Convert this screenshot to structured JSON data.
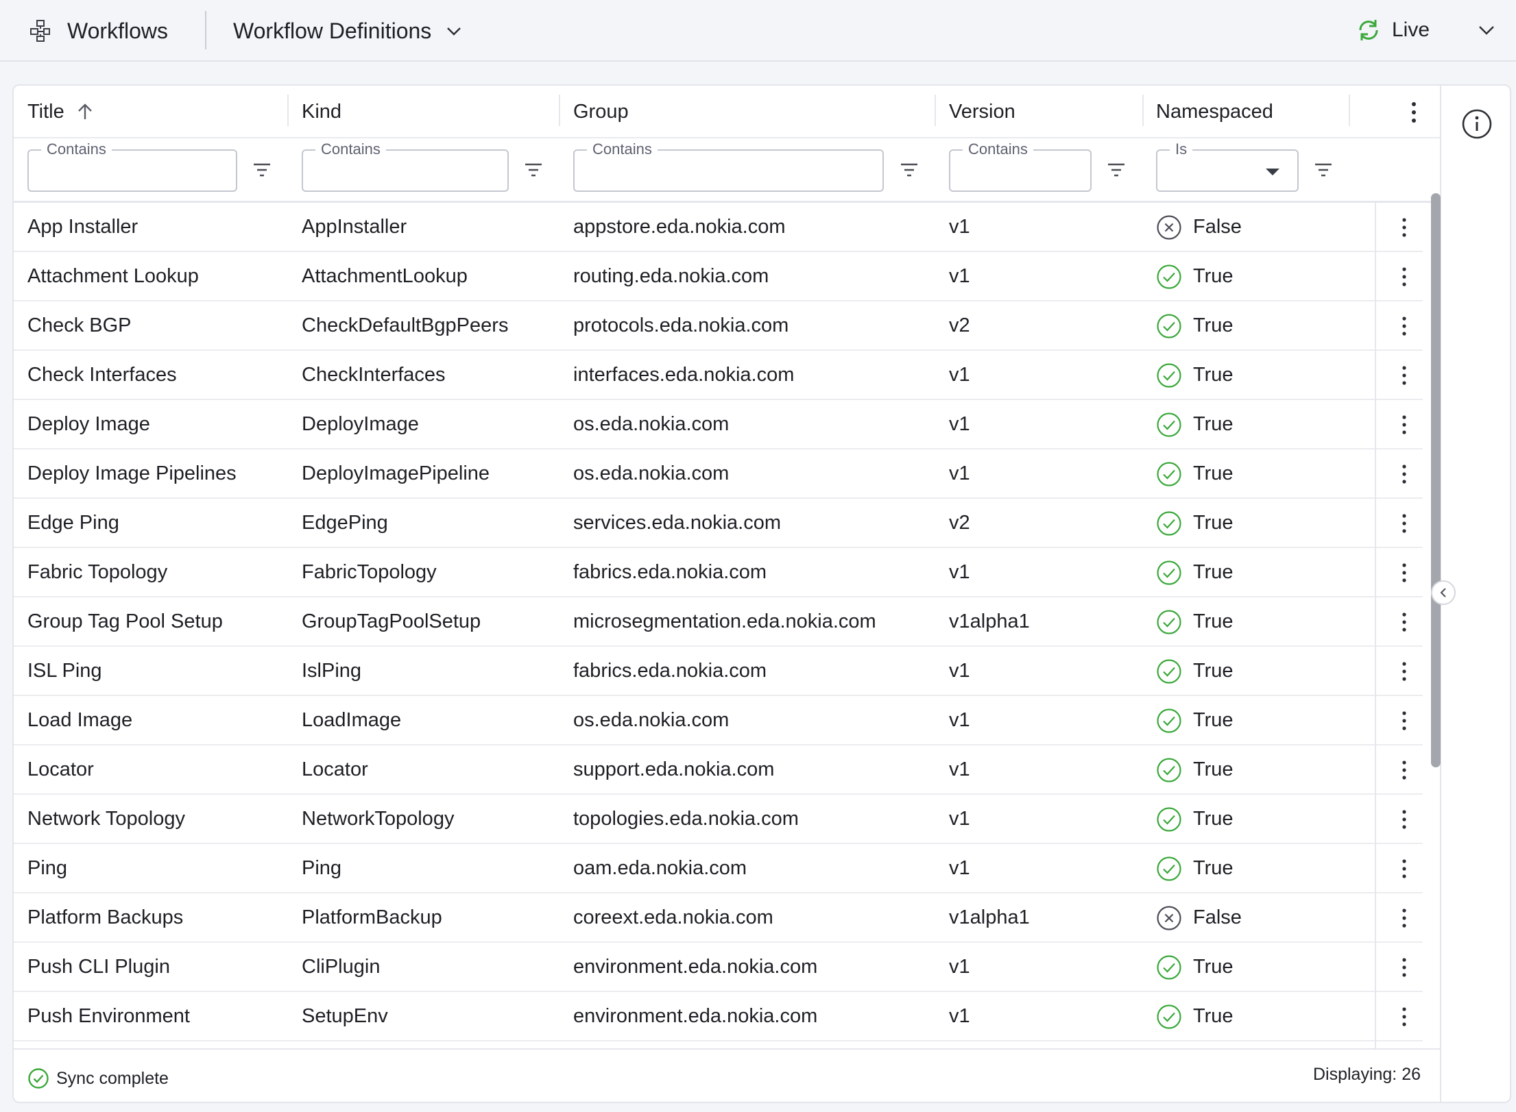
{
  "header": {
    "app_icon": "workflow-icon",
    "app_title": "Workflows",
    "view_title": "Workflow Definitions",
    "view_dropdown_icon": "chevron-down-icon",
    "live_icon": "refresh-icon",
    "live_label": "Live",
    "live_dropdown_icon": "chevron-down-icon"
  },
  "table": {
    "columns": [
      {
        "label": "Title",
        "sorted": "ascending",
        "filter_label": "Contains"
      },
      {
        "label": "Kind",
        "filter_label": "Contains"
      },
      {
        "label": "Group",
        "filter_label": "Contains"
      },
      {
        "label": "Version",
        "filter_label": "Contains"
      },
      {
        "label": "Namespaced",
        "filter_label": "Is"
      }
    ],
    "rows": [
      {
        "title": "App Installer",
        "kind": "AppInstaller",
        "group": "appstore.eda.nokia.com",
        "version": "v1",
        "namespaced": "False"
      },
      {
        "title": "Attachment Lookup",
        "kind": "AttachmentLookup",
        "group": "routing.eda.nokia.com",
        "version": "v1",
        "namespaced": "True"
      },
      {
        "title": "Check BGP",
        "kind": "CheckDefaultBgpPeers",
        "group": "protocols.eda.nokia.com",
        "version": "v2",
        "namespaced": "True"
      },
      {
        "title": "Check Interfaces",
        "kind": "CheckInterfaces",
        "group": "interfaces.eda.nokia.com",
        "version": "v1",
        "namespaced": "True"
      },
      {
        "title": "Deploy Image",
        "kind": "DeployImage",
        "group": "os.eda.nokia.com",
        "version": "v1",
        "namespaced": "True"
      },
      {
        "title": "Deploy Image Pipelines",
        "kind": "DeployImagePipeline",
        "group": "os.eda.nokia.com",
        "version": "v1",
        "namespaced": "True"
      },
      {
        "title": "Edge Ping",
        "kind": "EdgePing",
        "group": "services.eda.nokia.com",
        "version": "v2",
        "namespaced": "True"
      },
      {
        "title": "Fabric Topology",
        "kind": "FabricTopology",
        "group": "fabrics.eda.nokia.com",
        "version": "v1",
        "namespaced": "True"
      },
      {
        "title": "Group Tag Pool Setup",
        "kind": "GroupTagPoolSetup",
        "group": "microsegmentation.eda.nokia.com",
        "version": "v1alpha1",
        "namespaced": "True"
      },
      {
        "title": "ISL Ping",
        "kind": "IslPing",
        "group": "fabrics.eda.nokia.com",
        "version": "v1",
        "namespaced": "True"
      },
      {
        "title": "Load Image",
        "kind": "LoadImage",
        "group": "os.eda.nokia.com",
        "version": "v1",
        "namespaced": "True"
      },
      {
        "title": "Locator",
        "kind": "Locator",
        "group": "support.eda.nokia.com",
        "version": "v1",
        "namespaced": "True"
      },
      {
        "title": "Network Topology",
        "kind": "NetworkTopology",
        "group": "topologies.eda.nokia.com",
        "version": "v1",
        "namespaced": "True"
      },
      {
        "title": "Ping",
        "kind": "Ping",
        "group": "oam.eda.nokia.com",
        "version": "v1",
        "namespaced": "True"
      },
      {
        "title": "Platform Backups",
        "kind": "PlatformBackup",
        "group": "coreext.eda.nokia.com",
        "version": "v1alpha1",
        "namespaced": "False"
      },
      {
        "title": "Push CLI Plugin",
        "kind": "CliPlugin",
        "group": "environment.eda.nokia.com",
        "version": "v1",
        "namespaced": "True"
      },
      {
        "title": "Push Environment",
        "kind": "SetupEnv",
        "group": "environment.eda.nokia.com",
        "version": "v1",
        "namespaced": "True"
      }
    ]
  },
  "colors": {
    "true_icon": "#3aa83a",
    "false_icon": "#4a4d55",
    "live_icon": "#3aa83a"
  },
  "footer": {
    "sync_icon": "check-circle-icon",
    "sync_text": "Sync complete",
    "display_count": "Displaying: 26"
  },
  "side_panel": {
    "info_icon": "info-icon",
    "collapse_icon": "chevron-left-icon"
  }
}
